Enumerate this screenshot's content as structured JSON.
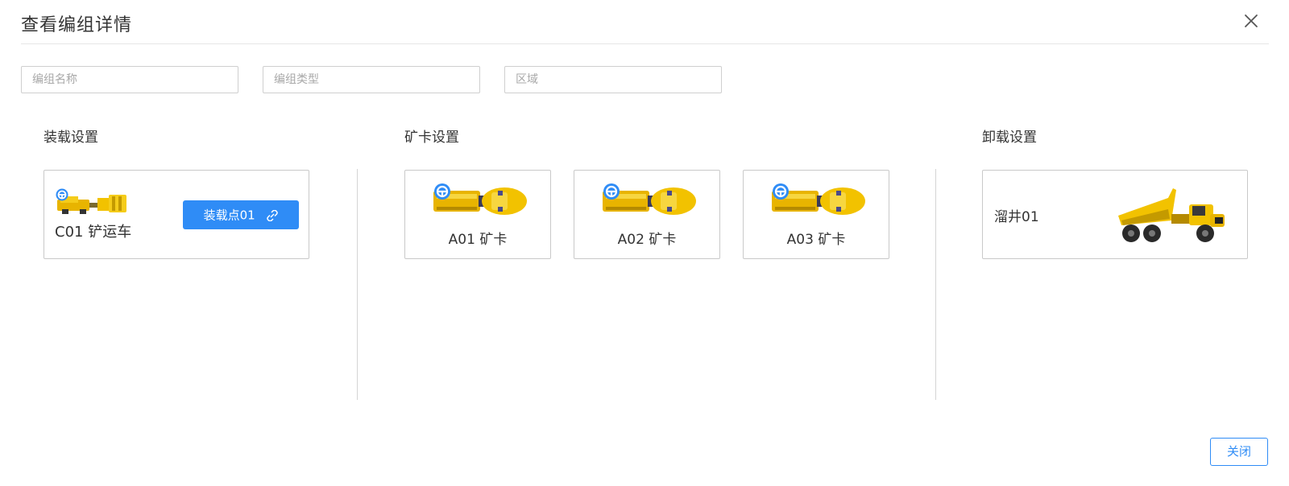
{
  "dialog": {
    "title": "查看编组详情",
    "close_icon": "close-icon",
    "footer_close_label": "关闭"
  },
  "filters": {
    "group_name_placeholder": "编组名称",
    "group_type_placeholder": "编组类型",
    "region_placeholder": "区域"
  },
  "loading": {
    "title": "装载设置",
    "vehicle_label": "C01 铲运车",
    "vehicle_icon": "loader-vehicle-icon",
    "load_point_label": "装载点01",
    "load_point_icon": "link-icon"
  },
  "trucks": {
    "title": "矿卡设置",
    "items": [
      {
        "label": "A01 矿卡",
        "icon": "mine-truck-icon"
      },
      {
        "label": "A02 矿卡",
        "icon": "mine-truck-icon"
      },
      {
        "label": "A03 矿卡",
        "icon": "mine-truck-icon"
      }
    ],
    "badge_icon": "steering-wheel-icon"
  },
  "unloading": {
    "title": "卸载设置",
    "point_label": "溜井01",
    "image_icon": "dump-truck-icon"
  },
  "colors": {
    "primary": "#2f8cf6",
    "vehicle_yellow": "#f2c200",
    "border": "#c9c9c9"
  }
}
